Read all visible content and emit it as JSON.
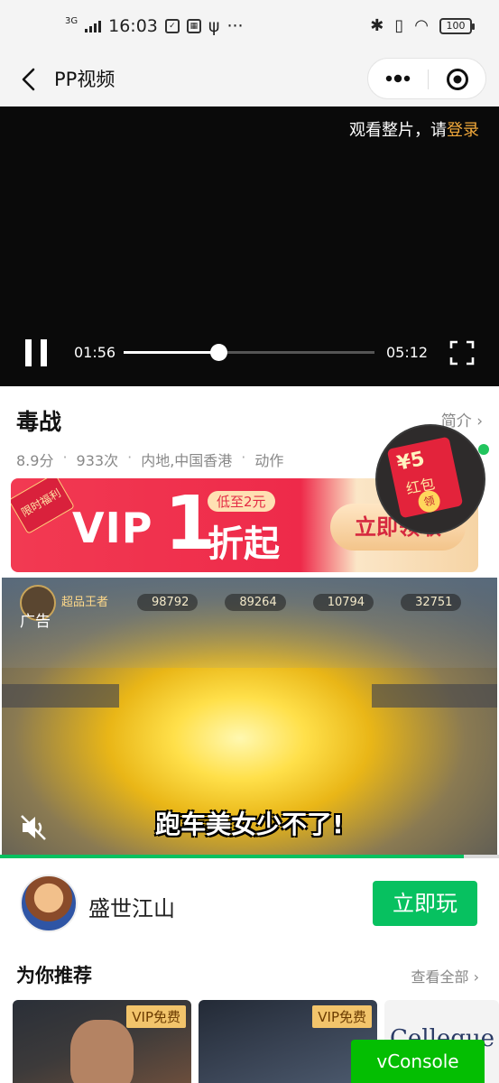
{
  "status_bar": {
    "network": "3G",
    "time": "16:03",
    "battery": "100"
  },
  "nav": {
    "title": "PP视频"
  },
  "player": {
    "login_hint": "观看整片，请",
    "login_link": "登录",
    "current_time": "01:56",
    "total_time": "05:12",
    "progress": 0.377
  },
  "movie": {
    "title": "毒战",
    "intro_link": "简介",
    "score": "8.9分",
    "plays": "933次",
    "region": "内地,中国香港",
    "genre": "动作"
  },
  "vip_banner": {
    "tag": "限时福利",
    "vip": "VIP",
    "number": "1",
    "low_price": "低至2元",
    "discount": "折起",
    "button": "立即领取"
  },
  "red_packet": {
    "amount": "¥5",
    "label": "红包",
    "coin": "领"
  },
  "ad": {
    "label": "广告",
    "player_name": "超品王者",
    "hud_values": [
      "98792",
      "89264",
      "10794",
      "32751"
    ],
    "caption": "跑车美女少不了!",
    "progress": 0.93
  },
  "ad_app": {
    "name": "盛世江山",
    "button": "立即玩"
  },
  "recommend": {
    "title": "为你推荐",
    "view_all": "查看全部",
    "cards": [
      {
        "badge": "VIP免费"
      },
      {
        "badge": "VIP免费"
      },
      {
        "brand": "Celleque"
      }
    ]
  },
  "vconsole": "vConsole",
  "colors": {
    "accent_green": "#07c160",
    "login_orange": "#f2a93b",
    "vip_red": "#ee2a4a"
  }
}
